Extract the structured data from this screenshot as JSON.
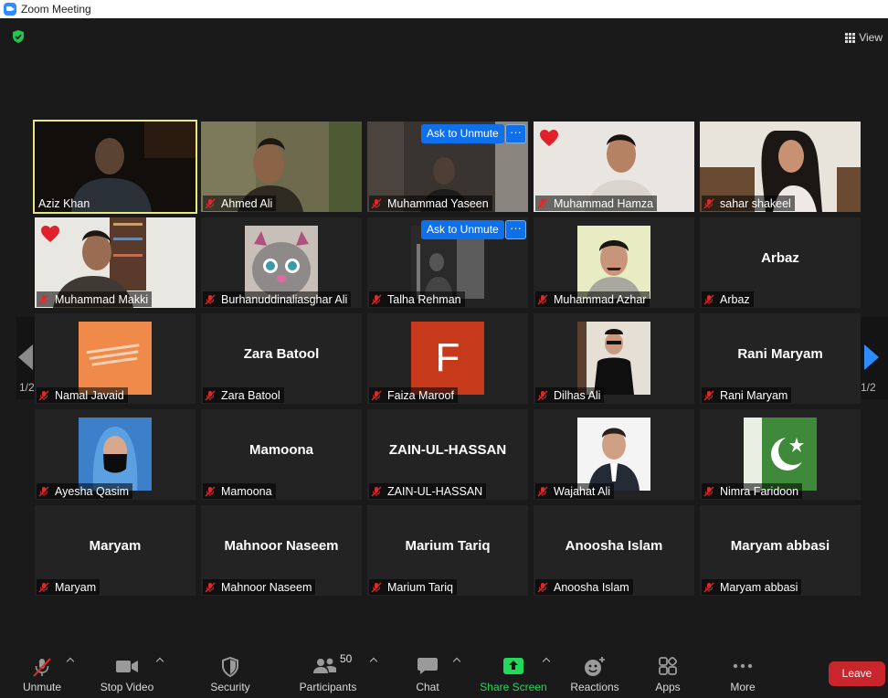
{
  "window": {
    "title": "Zoom Meeting"
  },
  "top": {
    "view_label": "View"
  },
  "pagination": {
    "left": "1/2",
    "right": "1/2"
  },
  "ask_to_unmute": "Ask to Unmute",
  "more_dots": "···",
  "participants": [
    {
      "name": "Aziz Khan",
      "kind": "video",
      "active": true
    },
    {
      "name": "Ahmed Ali",
      "kind": "video",
      "muted": true
    },
    {
      "name": "Muhammad Yaseen",
      "kind": "video",
      "muted": true,
      "ask_unmute": true
    },
    {
      "name": "Muhammad Hamza",
      "kind": "video",
      "muted": true,
      "heart": true
    },
    {
      "name": "sahar shakeel",
      "kind": "video",
      "muted": true
    },
    {
      "name": "Muhammad Makki",
      "kind": "video",
      "muted": true,
      "heart": true
    },
    {
      "name": "Burhanuddinaliasghar Ali",
      "kind": "photo",
      "muted": true
    },
    {
      "name": "Talha Rehman",
      "kind": "photo",
      "muted": true,
      "ask_unmute": true
    },
    {
      "name": "Muhammad Azhar",
      "kind": "photo",
      "muted": true
    },
    {
      "name": "Arbaz",
      "kind": "name",
      "muted": true
    },
    {
      "name": "Namal Javaid",
      "kind": "photo",
      "muted": true
    },
    {
      "name": "Zara Batool",
      "kind": "name",
      "muted": true
    },
    {
      "name": "Faiza Maroof",
      "kind": "letter",
      "letter": "F",
      "muted": true
    },
    {
      "name": "Dilhas Ali",
      "kind": "photo",
      "muted": true
    },
    {
      "name": "Rani Maryam",
      "kind": "name",
      "muted": true
    },
    {
      "name": "Ayesha Qasim",
      "kind": "photo",
      "muted": true
    },
    {
      "name": "Mamoona",
      "kind": "name",
      "muted": true
    },
    {
      "name": "ZAIN-UL-HASSAN",
      "kind": "name",
      "muted": true
    },
    {
      "name": "Wajahat Ali",
      "kind": "photo",
      "muted": true
    },
    {
      "name": "Nimra Faridoon",
      "kind": "photo",
      "muted": true
    },
    {
      "name": "Maryam",
      "kind": "name",
      "muted": true
    },
    {
      "name": "Mahnoor Naseem",
      "kind": "name",
      "muted": true
    },
    {
      "name": "Marium Tariq",
      "kind": "name",
      "muted": true
    },
    {
      "name": "Anoosha Islam",
      "kind": "name",
      "muted": true
    },
    {
      "name": "Maryam abbasi",
      "kind": "name",
      "muted": true
    }
  ],
  "toolbar": {
    "unmute": "Unmute",
    "stop_video": "Stop Video",
    "security": "Security",
    "participants": "Participants",
    "participants_count": "50",
    "chat": "Chat",
    "share_screen": "Share Screen",
    "reactions": "Reactions",
    "apps": "Apps",
    "more": "More",
    "leave": "Leave"
  },
  "colors": {
    "accent": "#0e71eb",
    "active_speaker": "#e6e87d",
    "share_green": "#23d959",
    "leave_red": "#c8252c",
    "mute_red": "#e02828"
  }
}
